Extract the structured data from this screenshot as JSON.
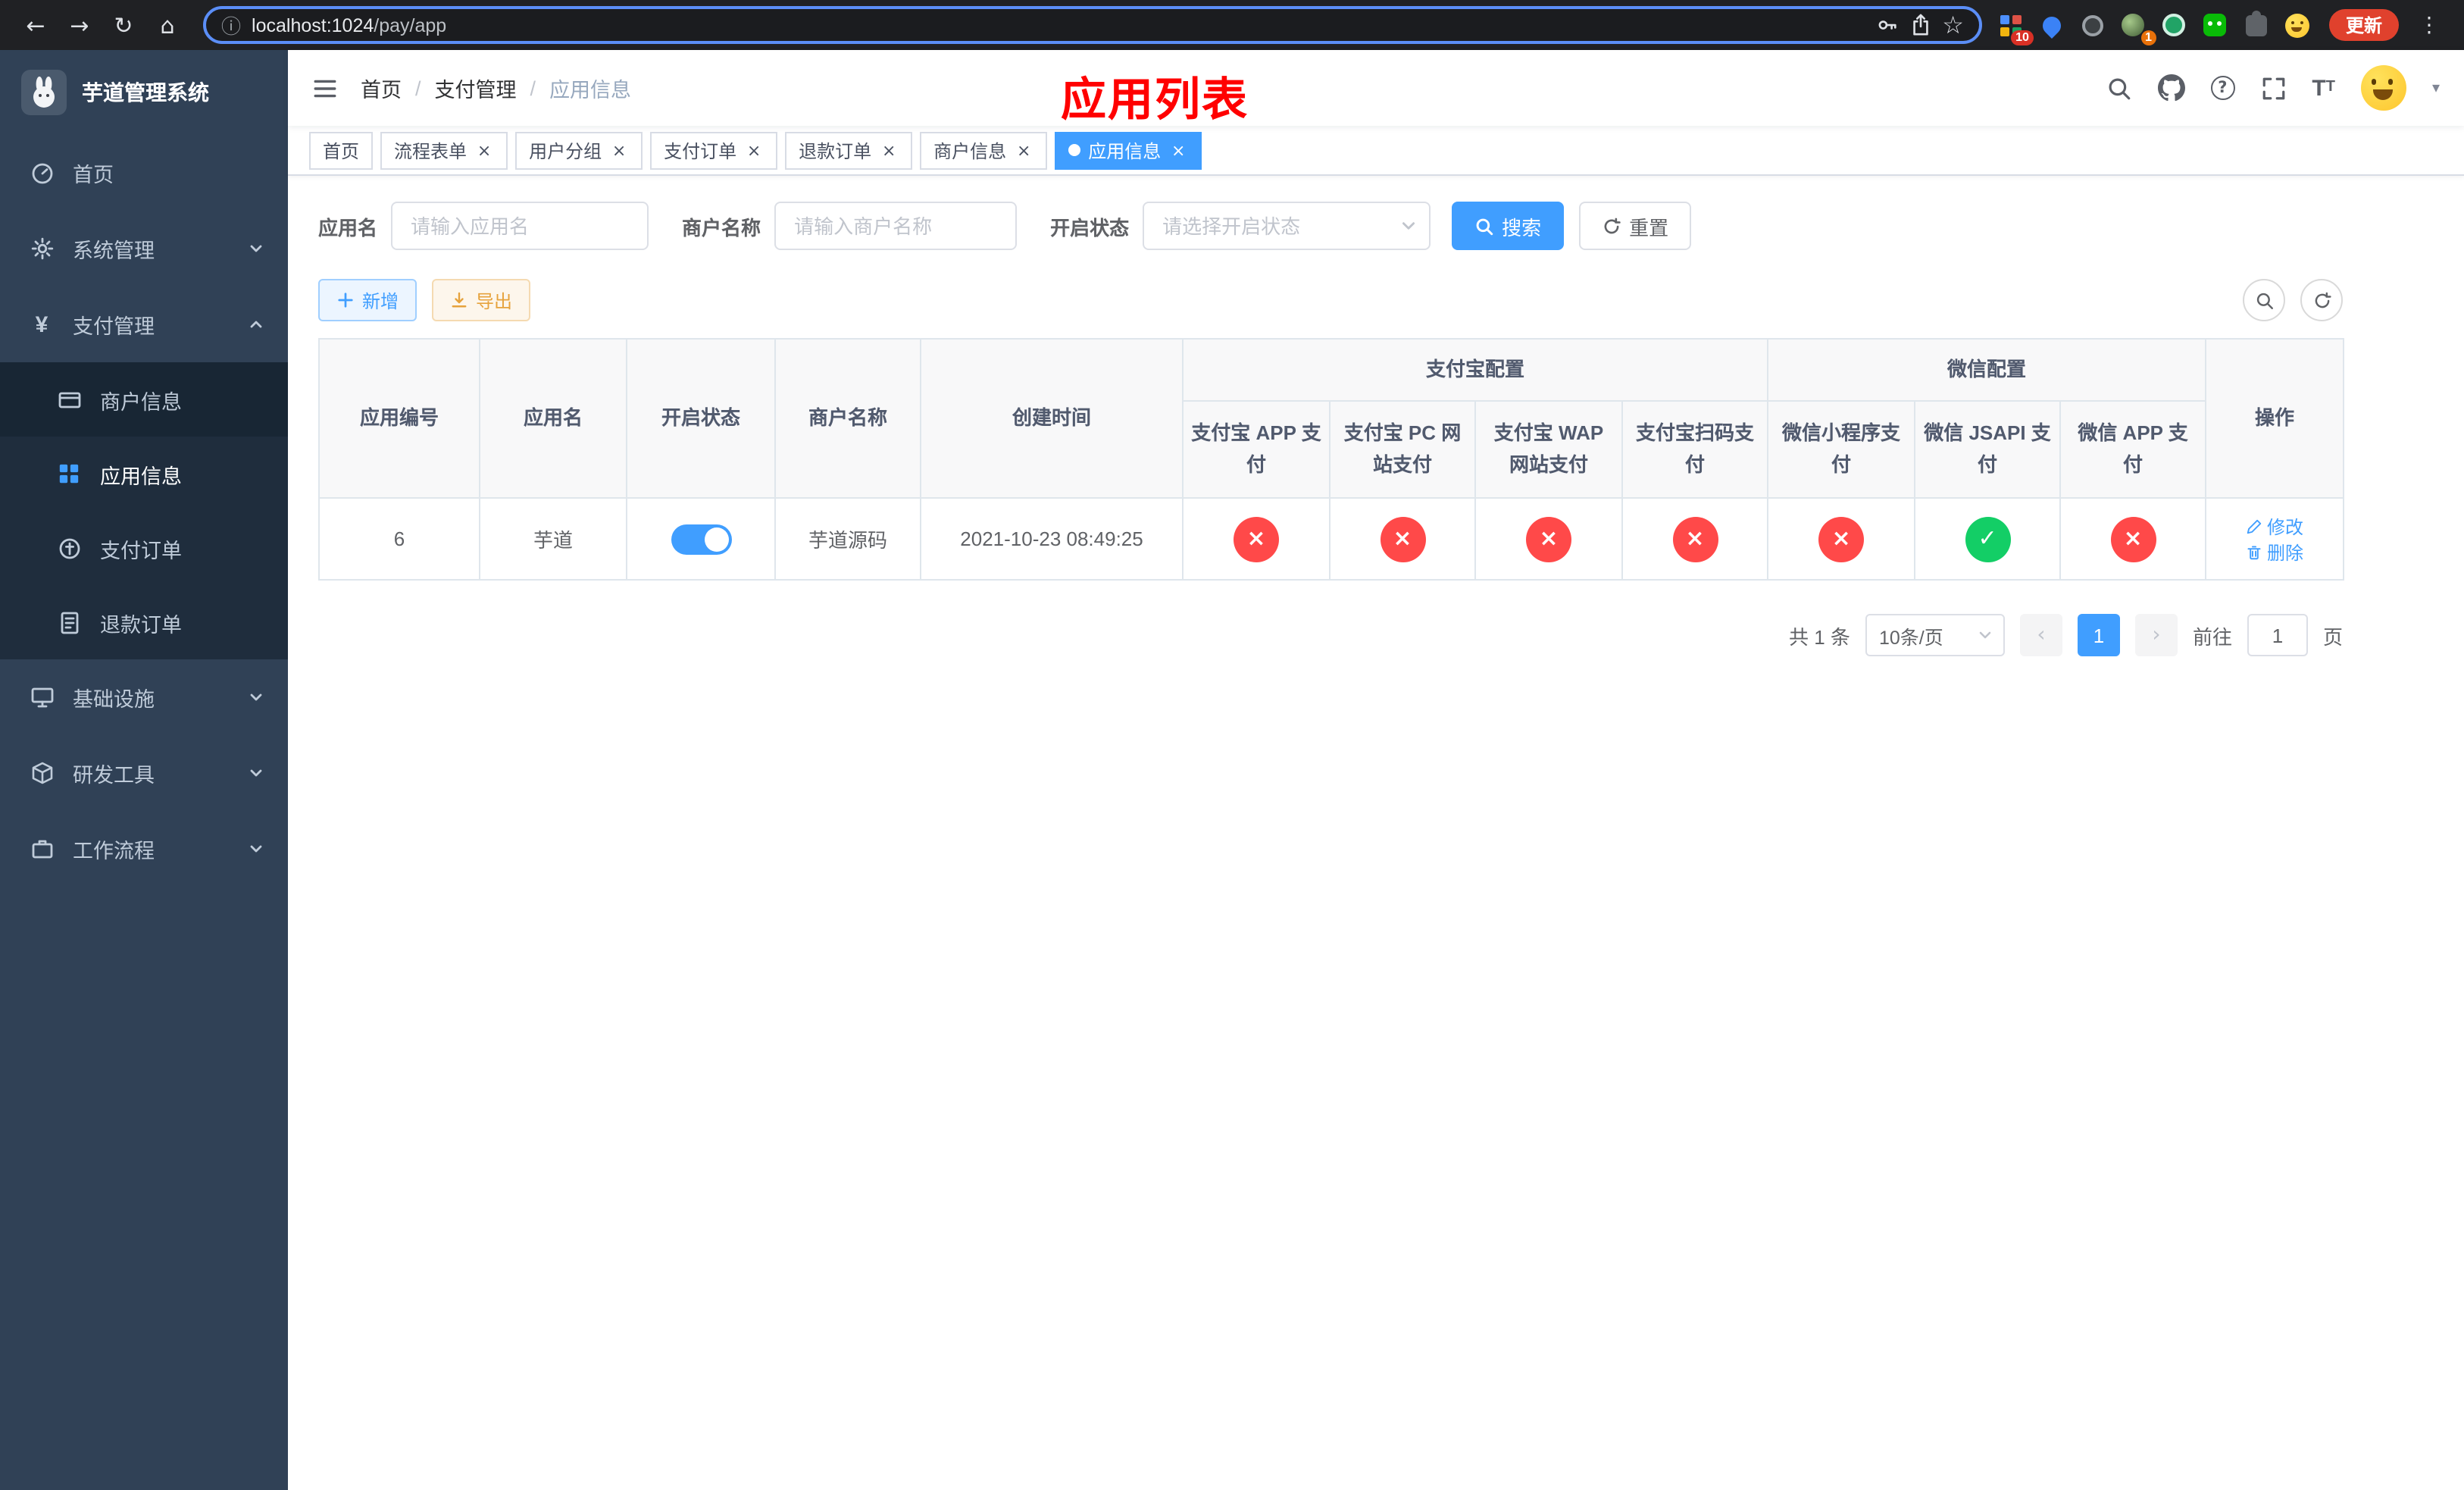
{
  "icons": {
    "back": "←",
    "forward": "→",
    "reload": "↻",
    "home": "⌂",
    "info": "ⓘ",
    "star": "☆",
    "kebab": "⋮",
    "caret": "▾",
    "prev": "‹",
    "next": "›",
    "close": "×",
    "check": "✓",
    "cross": "×",
    "dot": "●",
    "question": "?",
    "letter_t": "T"
  },
  "browser": {
    "url_host": "localhost:1024",
    "url_path": "/pay/app",
    "update_button": "更新",
    "extension_badge_grid": "10",
    "extension_badge_avatar": "1"
  },
  "sidebar": {
    "title": "芋道管理系统",
    "items": [
      {
        "label": "首页"
      },
      {
        "label": "系统管理"
      },
      {
        "label": "支付管理"
      },
      {
        "label": "商户信息"
      },
      {
        "label": "应用信息"
      },
      {
        "label": "支付订单"
      },
      {
        "label": "退款订单"
      },
      {
        "label": "基础设施"
      },
      {
        "label": "研发工具"
      },
      {
        "label": "工作流程"
      }
    ]
  },
  "header": {
    "breadcrumb": [
      {
        "label": "首页"
      },
      {
        "label": "支付管理"
      },
      {
        "label": "应用信息"
      }
    ],
    "annotation": "应用列表"
  },
  "tabs": [
    {
      "label": "首页"
    },
    {
      "label": "流程表单"
    },
    {
      "label": "用户分组"
    },
    {
      "label": "支付订单"
    },
    {
      "label": "退款订单"
    },
    {
      "label": "商户信息"
    },
    {
      "label": "应用信息"
    }
  ],
  "filter": {
    "app_name_label": "应用名",
    "app_name_placeholder": "请输入应用名",
    "merchant_label": "商户名称",
    "merchant_placeholder": "请输入商户名称",
    "status_label": "开启状态",
    "status_placeholder": "请选择开启状态",
    "search_button": "搜索",
    "reset_button": "重置"
  },
  "toolbar": {
    "add_button": "新增",
    "export_button": "导出"
  },
  "table": {
    "group_alipay": "支付宝配置",
    "group_wechat": "微信配置",
    "col_id": "应用编号",
    "col_name": "应用名",
    "col_status": "开启状态",
    "col_merchant": "商户名称",
    "col_created": "创建时间",
    "col_actions": "操作",
    "sub_columns": [
      "支付宝 APP 支付",
      "支付宝 PC 网站支付",
      "支付宝 WAP 网站支付",
      "支付宝扫码支付",
      "微信小程序支付",
      "微信 JSAPI 支付",
      "微信 APP 支付"
    ],
    "row": {
      "id": "6",
      "name": "芋道",
      "enabled": true,
      "merchant": "芋道源码",
      "created": "2021-10-23 08:49:25",
      "channels": {
        "alipay_app": false,
        "alipay_pc": false,
        "alipay_wap": false,
        "alipay_qr": false,
        "wechat_lite": false,
        "wechat_jsapi": true,
        "wechat_app": false
      },
      "edit": "修改",
      "delete": "删除"
    }
  },
  "pagination": {
    "total": "共 1 条",
    "page_size": "10条/页",
    "current_page": "1",
    "goto_label": "前往",
    "goto_value": "1",
    "goto_unit": "页"
  },
  "colors": {
    "accent": "#409eff",
    "danger": "#ff4949",
    "success": "#13ce66",
    "warning": "#e6a23c",
    "sidebar_bg": "#304156",
    "submenu_bg": "#1f2d3d",
    "annotation_red": "#ff0000"
  }
}
